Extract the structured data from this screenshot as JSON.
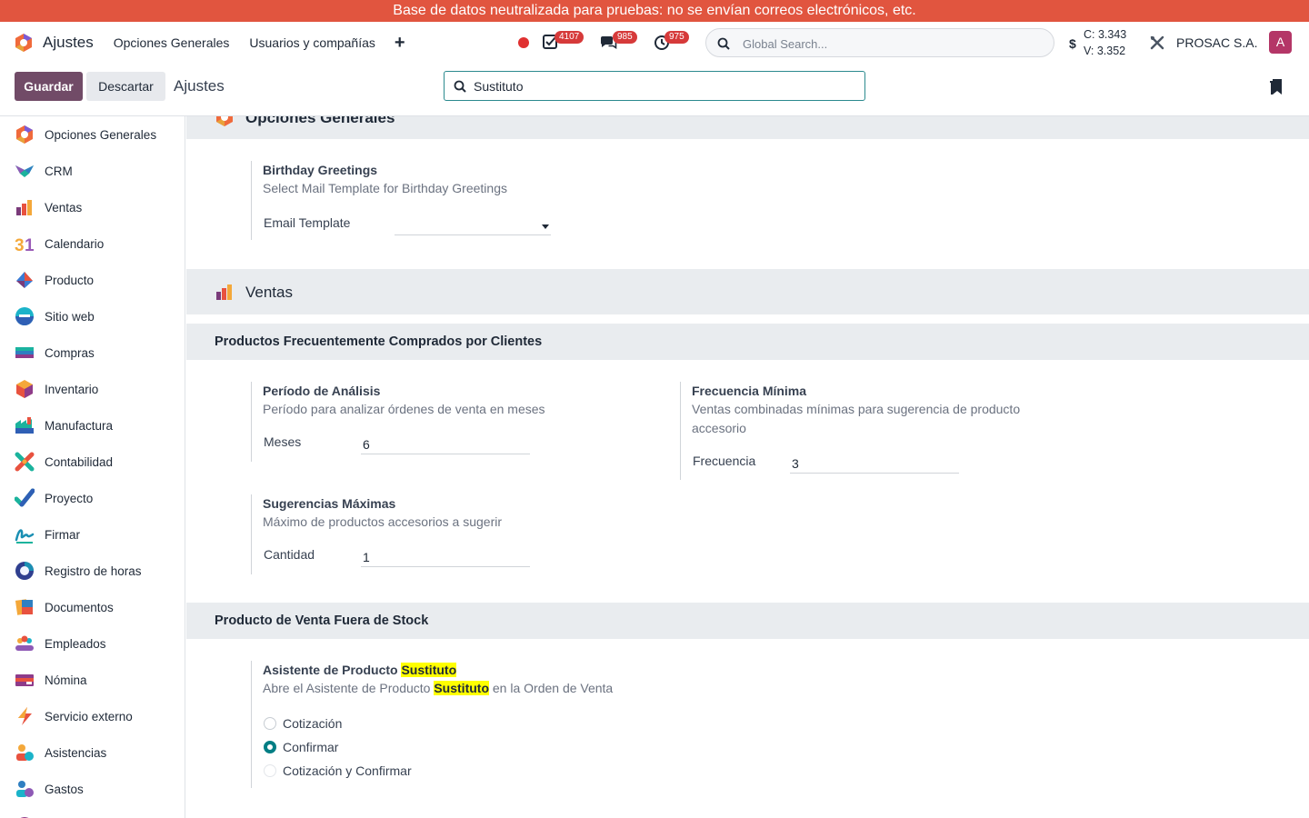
{
  "banner": "Base de datos neutralizada para pruebas: no se envían correos electrónicos, etc.",
  "navbar": {
    "app_name": "Ajustes",
    "menus": [
      "Opciones Generales",
      "Usuarios y compañías"
    ],
    "plus": "+",
    "badges": {
      "activities": "4107",
      "messages": "985",
      "timesheets": "975"
    },
    "search_placeholder": "Global Search...",
    "currency_symbol": "$",
    "rate_c": "C: 3.343",
    "rate_v": "V: 3.352",
    "company": "PROSAC S.A.",
    "avatar_letter": "A"
  },
  "control": {
    "save_label": "Guardar",
    "discard_label": "Descartar",
    "title": "Ajustes",
    "search_value": "Sustituto"
  },
  "sidebar": {
    "items": [
      {
        "label": "Opciones Generales",
        "icon": "general-settings-icon"
      },
      {
        "label": "CRM",
        "icon": "crm-icon"
      },
      {
        "label": "Ventas",
        "icon": "sales-icon"
      },
      {
        "label": "Calendario",
        "icon": "calendar-icon"
      },
      {
        "label": "Producto",
        "icon": "product-icon"
      },
      {
        "label": "Sitio web",
        "icon": "website-icon"
      },
      {
        "label": "Compras",
        "icon": "purchase-icon"
      },
      {
        "label": "Inventario",
        "icon": "inventory-icon"
      },
      {
        "label": "Manufactura",
        "icon": "manufacturing-icon"
      },
      {
        "label": "Contabilidad",
        "icon": "accounting-icon"
      },
      {
        "label": "Proyecto",
        "icon": "project-icon"
      },
      {
        "label": "Firmar",
        "icon": "sign-icon"
      },
      {
        "label": "Registro de horas",
        "icon": "timesheet-icon"
      },
      {
        "label": "Documentos",
        "icon": "documents-icon"
      },
      {
        "label": "Empleados",
        "icon": "employees-icon"
      },
      {
        "label": "Nómina",
        "icon": "payroll-icon"
      },
      {
        "label": "Servicio externo",
        "icon": "field-service-icon"
      },
      {
        "label": "Asistencias",
        "icon": "attendance-icon"
      },
      {
        "label": "Gastos",
        "icon": "expenses-icon"
      }
    ]
  },
  "content": {
    "general": {
      "title": "Opciones Generales",
      "birthday": {
        "title": "Birthday Greetings",
        "desc": "Select Mail Template for Birthday Greetings",
        "field_label": "Email Template",
        "field_value": ""
      }
    },
    "sales": {
      "title": "Ventas",
      "section1": "Productos Frecuentemente Comprados por Clientes",
      "periodo": {
        "title": "Período de Análisis",
        "desc": "Período para analizar órdenes de venta en meses",
        "field_label": "Meses",
        "field_value": "6"
      },
      "frecuencia": {
        "title": "Frecuencia Mínima",
        "desc": "Ventas combinadas mínimas para sugerencia de producto accesorio",
        "field_label": "Frecuencia",
        "field_value": "3"
      },
      "sugerencias": {
        "title": "Sugerencias Máximas",
        "desc": "Máximo de productos accesorios a sugerir",
        "field_label": "Cantidad",
        "field_value": "1"
      },
      "section2": "Producto de Venta Fuera de Stock",
      "asistente": {
        "title_prefix": "Asistente de Producto ",
        "title_highlight": "Sustituto",
        "desc_prefix": "Abre el Asistente de Producto ",
        "desc_highlight": "Sustituto",
        "desc_suffix": " en la Orden de Venta",
        "options": [
          "Cotización",
          "Confirmar",
          "Cotización y Confirmar"
        ],
        "selected": "Confirmar"
      }
    }
  }
}
